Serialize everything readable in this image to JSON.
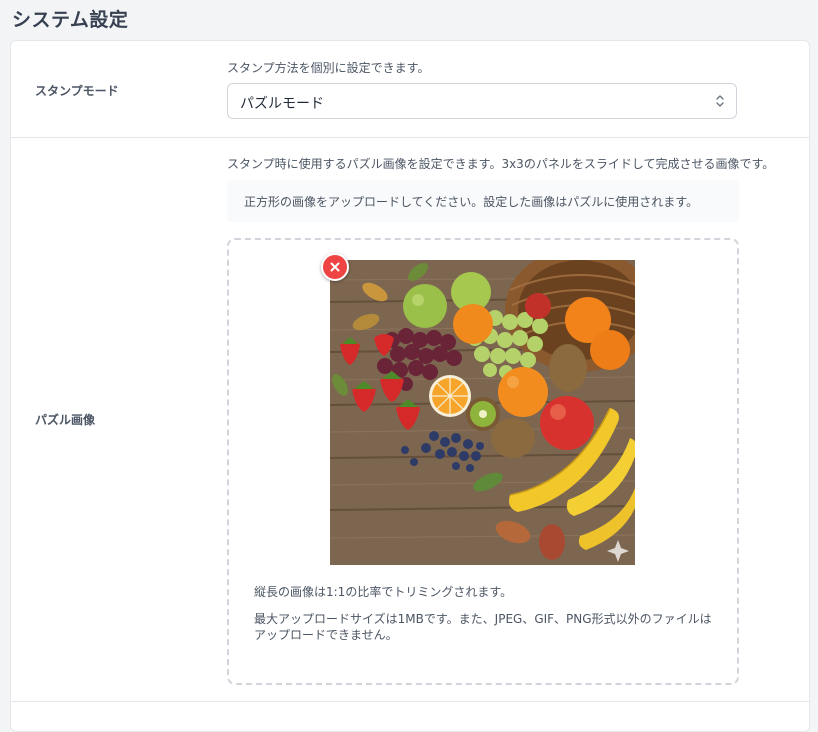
{
  "page": {
    "title": "システム設定"
  },
  "stamp_mode": {
    "label": "スタンプモード",
    "description": "スタンプ方法を個別に設定できます。",
    "selected": "パズルモード"
  },
  "puzzle_image": {
    "label": "パズル画像",
    "description": "スタンプ時に使用するパズル画像を設定できます。3x3のパネルをスライドして完成させる画像です。",
    "notice": "正方形の画像をアップロードしてください。設定した画像はパズルに使用されます。",
    "note_trim": "縦長の画像は1:1の比率でトリミングされます。",
    "note_size_line1": "最大アップロードサイズは1MBです。また、JPEG、GIF、PNG形式以外のファイルは",
    "note_size_line2": "アップロードできません。",
    "remove_icon": "close-icon",
    "preview_icon": "sparkle-icon"
  },
  "colors": {
    "accent_remove": "#ef4444",
    "border": "#e5e7eb",
    "notice_bg": "#f9fafb"
  }
}
